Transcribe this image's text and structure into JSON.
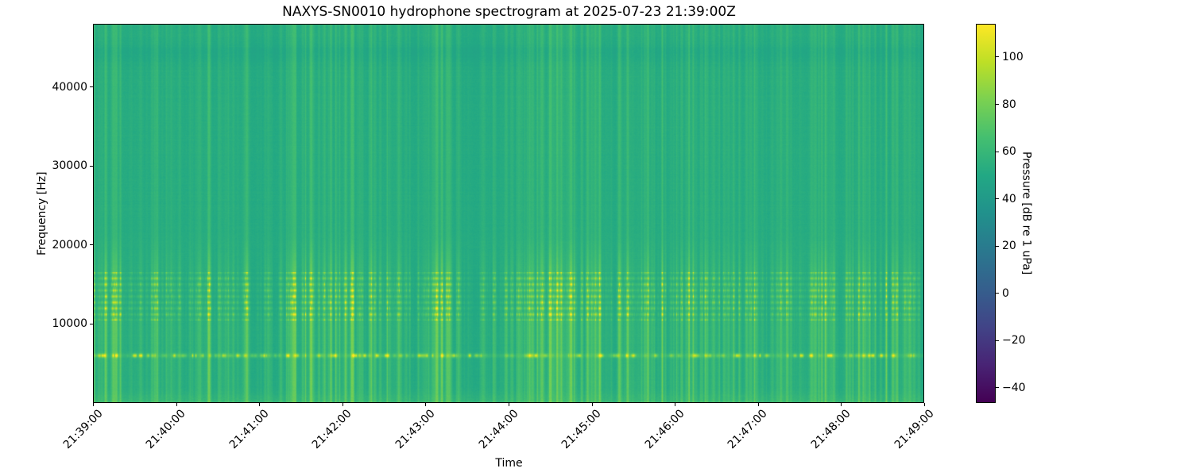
{
  "chart_data": {
    "type": "heatmap",
    "variant": "spectrogram",
    "title": "NAXYS-SN0010 hydrophone spectrogram at 2025-07-23 21:39:00Z",
    "xlabel": "Time",
    "ylabel": "Frequency [Hz]",
    "x_tick_labels": [
      "21:39:00",
      "21:40:00",
      "21:41:00",
      "21:42:00",
      "21:43:00",
      "21:44:00",
      "21:45:00",
      "21:46:00",
      "21:47:00",
      "21:48:00",
      "21:49:00"
    ],
    "x_range_minutes": [
      0,
      10
    ],
    "ylim": [
      0,
      48000
    ],
    "y_tick_values": [
      10000,
      20000,
      30000,
      40000
    ],
    "y_tick_labels": [
      "10000",
      "20000",
      "30000",
      "40000"
    ],
    "grid": false,
    "colorbar": {
      "label": "Pressure [dB re 1 uPa]",
      "tick_values": [
        100,
        80,
        60,
        40,
        20,
        0,
        -20,
        -40
      ],
      "tick_labels": [
        "100",
        "80",
        "60",
        "40",
        "20",
        "0",
        "−20",
        "−40"
      ],
      "vmin": -46.4,
      "vmax": 114.1,
      "colormap": "viridis",
      "stops": [
        "#440154",
        "#482475",
        "#414487",
        "#355f8d",
        "#2a788e",
        "#21918c",
        "#22a884",
        "#44bf70",
        "#7ad151",
        "#bddf26",
        "#fde725"
      ]
    },
    "background_db": 51,
    "features": {
      "description": "teal background ~51 dB with broadband vertical impulse streaks; bright intermittent tonal band near 6 kHz; dotted horizontal texture band 10.5-16.6 kHz; slightly darker band near 44 kHz; brighter dappled strip below 2.3 kHz",
      "bands": [
        {
          "name": "tonal-band-6khz",
          "f_center": 6050,
          "f_sigma": 300,
          "boost_db": 6,
          "blob_sigma": 230
        },
        {
          "name": "texture-band",
          "f_lo": 10500,
          "f_hi": 16600,
          "row_period_hz": 760,
          "gain_boost": 1.1,
          "base_ripple_db": 1.4
        },
        {
          "name": "high-freq-dip",
          "f_center": 44300,
          "f_sigma": 1400,
          "depth_db": 3.2
        },
        {
          "name": "low-freq-strip",
          "f_hi": 2300,
          "boost_db": 7
        }
      ],
      "streak_gain_profile": [
        [
          0,
          0.75
        ],
        [
          2300,
          0.95
        ],
        [
          10500,
          1.0
        ],
        [
          16600,
          0.85
        ],
        [
          21000,
          0.42
        ],
        [
          43000,
          0.5
        ],
        [
          48000,
          0.5
        ]
      ],
      "activity_profile": [
        [
          0,
          0.8
        ],
        [
          0.3,
          0.95
        ],
        [
          0.7,
          0.6
        ],
        [
          1.05,
          0.85
        ],
        [
          1.4,
          0.8
        ],
        [
          1.75,
          0.5
        ],
        [
          2.1,
          0.65
        ],
        [
          2.55,
          1.0
        ],
        [
          2.85,
          0.7
        ],
        [
          3.2,
          0.8
        ],
        [
          3.6,
          0.9
        ],
        [
          4.05,
          0.85
        ],
        [
          4.45,
          0.65
        ],
        [
          4.85,
          0.45
        ],
        [
          5.25,
          0.6
        ],
        [
          5.65,
          0.8
        ],
        [
          6.05,
          0.55
        ],
        [
          6.45,
          0.75
        ],
        [
          6.95,
          0.45
        ],
        [
          7.35,
          0.5
        ],
        [
          7.8,
          0.8
        ],
        [
          8.25,
          0.55
        ],
        [
          8.7,
          0.9
        ],
        [
          9.15,
          0.7
        ],
        [
          9.55,
          0.95
        ],
        [
          9.95,
          0.85
        ]
      ],
      "render": {
        "seed": 7,
        "narrow_streaks": 460,
        "wide_streaks": 90,
        "tonal_blobs": 240
      }
    }
  }
}
